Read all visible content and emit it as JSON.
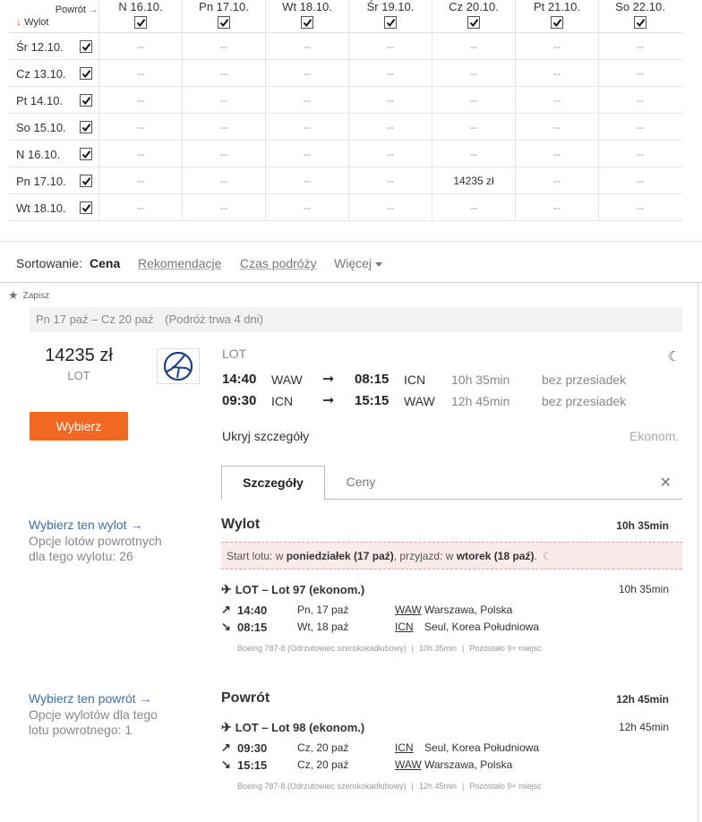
{
  "matrix": {
    "return_label": "Powrót",
    "return_arrow": "→",
    "depart_label": "Wylot",
    "depart_arrow": "↓",
    "columns": [
      "N 16.10.",
      "Pn 17.10.",
      "Wt 18.10.",
      "Śr 19.10.",
      "Cz 20.10.",
      "Pt 21.10.",
      "So 22.10."
    ],
    "rows": [
      {
        "label": "Śr 12.10.",
        "cells": [
          "--",
          "--",
          "--",
          "--",
          "--",
          "--",
          "--"
        ]
      },
      {
        "label": "Cz 13.10.",
        "cells": [
          "--",
          "--",
          "--",
          "--",
          "--",
          "--",
          "--"
        ]
      },
      {
        "label": "Pt 14.10.",
        "cells": [
          "--",
          "--",
          "--",
          "--",
          "--",
          "--",
          "--"
        ]
      },
      {
        "label": "So 15.10.",
        "cells": [
          "--",
          "--",
          "--",
          "--",
          "--",
          "--",
          "--"
        ]
      },
      {
        "label": "N 16.10.",
        "cells": [
          "--",
          "--",
          "--",
          "--",
          "--",
          "--",
          "--"
        ]
      },
      {
        "label": "Pn 17.10.",
        "cells": [
          "--",
          "--",
          "--",
          "--",
          "14235 zł",
          "--",
          "--"
        ]
      },
      {
        "label": "Wt 18.10.",
        "cells": [
          "--",
          "--",
          "--",
          "--",
          "--",
          "--",
          "--"
        ]
      }
    ]
  },
  "sort": {
    "label": "Sortowanie:",
    "active": "Cena",
    "options": [
      "Rekomendacje",
      "Czas podróży"
    ],
    "more": "Więcej"
  },
  "result": {
    "save_label": "Zapisz",
    "trip_dates": "Pn 17 paź – Cz 20 paź",
    "trip_duration": "(Podróż trwa 4 dni)",
    "price": "14235 zł",
    "price_airline": "LOT",
    "select_button": "Wybierz",
    "airline_name": "LOT",
    "legs": [
      {
        "dep_time": "14:40",
        "dep_ap": "WAW",
        "arr_time": "08:15",
        "arr_ap": "ICN",
        "duration": "10h 35min",
        "stops": "bez przesiadek"
      },
      {
        "dep_time": "09:30",
        "dep_ap": "ICN",
        "arr_time": "15:15",
        "arr_ap": "WAW",
        "duration": "12h 45min",
        "stops": "bez przesiadek"
      }
    ],
    "hide_details": "Ukryj szczegóły",
    "cabin": "Ekonom.",
    "tabs": [
      "Szczegóły",
      "Ceny"
    ],
    "outbound": {
      "side_link": "Wybierz ten wylot →",
      "side_desc": "Opcje lotów powrotnych dla tego wylotu: 26",
      "title": "Wylot",
      "duration": "10h 35min",
      "alert_pre": "Start lotu: w",
      "alert_day1": "poniedziałek (17 paź)",
      "alert_mid": ", przyjazd: w",
      "alert_day2": "wtorek (18 paź)",
      "flight": "LOT – Lot 97 (ekonom.)",
      "flight_duration": "10h 35min",
      "dep_time": "14:40",
      "dep_date": "Pn, 17 paź",
      "dep_code": "WAW",
      "dep_city": "Warszawa, Polska",
      "arr_time": "08:15",
      "arr_date": "Wt, 18 paź",
      "arr_code": "ICN",
      "arr_city": "Seul, Korea Południowa",
      "aircraft": "Boeing 787-8 (Odrzutowiec szerokokadłubowy)",
      "meta_duration": "10h 35min",
      "seats": "Pozostało 9+ miejsc"
    },
    "inbound": {
      "side_link": "Wybierz ten powrót →",
      "side_desc": "Opcje wylotów dla tego lotu powrotnego: 1",
      "title": "Powrót",
      "duration": "12h 45min",
      "flight": "LOT – Lot 98 (ekonom.)",
      "flight_duration": "12h 45min",
      "dep_time": "09:30",
      "dep_date": "Cz, 20 paź",
      "dep_code": "ICN",
      "dep_city": "Seul, Korea Południowa",
      "arr_time": "15:15",
      "arr_date": "Cz, 20 paź",
      "arr_code": "WAW",
      "arr_city": "Warszawa, Polska",
      "aircraft": "Boeing 787-8 (Odrzutowiec szerokokadłubowy)",
      "meta_duration": "12h 45min",
      "seats": "Pozostało 9+ miejsc"
    }
  },
  "colors": {
    "accent": "#f26822",
    "link": "#3b6fb6",
    "brand_lot": "#1c3f8f"
  }
}
